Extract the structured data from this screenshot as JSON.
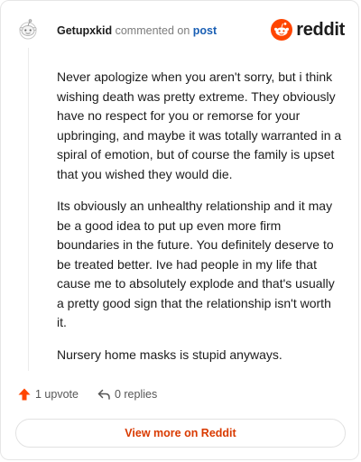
{
  "header": {
    "username": "Getupxkid",
    "action_text": "commented on",
    "post_link": "post",
    "brand": "reddit"
  },
  "comment": {
    "paragraphs": [
      "Never apologize when you aren't sorry, but i think wishing death was pretty extreme. They obviously have no respect for you or remorse for your upbringing, and maybe it was totally warranted in a spiral of emotion, but of course the family is upset that you wished they would die.",
      "Its obviously an unhealthy relationship and it may be a good idea to put up even more firm boundaries in the future. You definitely deserve to be treated better. Ive had people in my life that cause me to absolutely explode and that's usually a pretty good sign that the relationship isn't worth it.",
      "Nursery home masks is stupid anyways."
    ]
  },
  "actions": {
    "upvotes": "1 upvote",
    "replies": "0 replies"
  },
  "footer": {
    "view_more": "View more on Reddit"
  },
  "colors": {
    "brand_orange": "#ff4500",
    "link_blue": "#1a5fb4",
    "view_more_text": "#d93a00"
  },
  "icons": {
    "avatar": "snoo-avatar-icon",
    "logo": "reddit-snoo-logo-icon",
    "upvote": "upvote-arrow-icon",
    "reply": "reply-arrow-icon"
  }
}
